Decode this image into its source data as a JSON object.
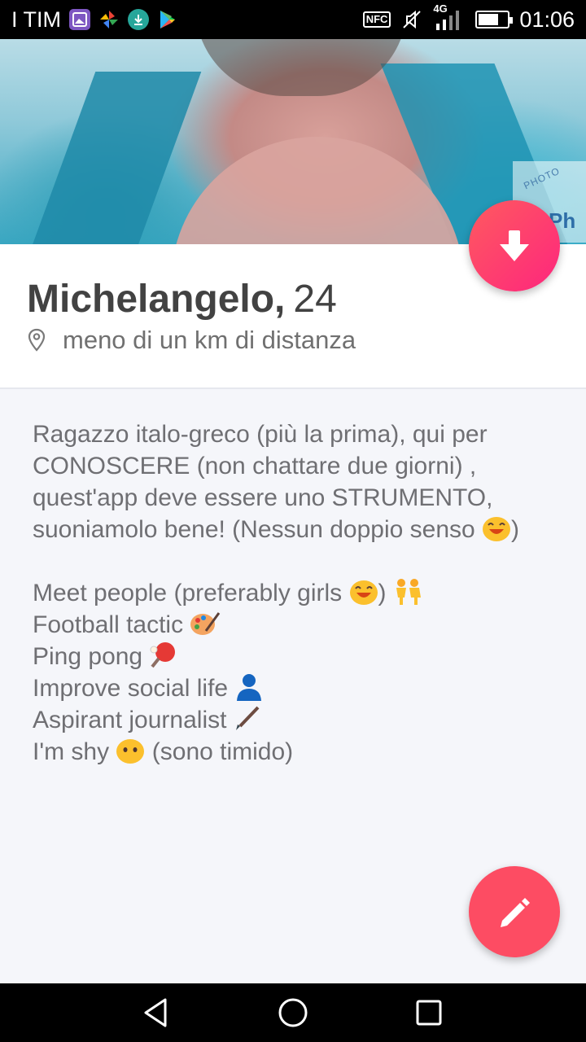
{
  "status_bar": {
    "carrier": "I TIM",
    "network": "4G",
    "time": "01:06",
    "icons": [
      "gallery-icon",
      "pinwheel-icon",
      "download-icon",
      "play-store-icon",
      "nfc-icon",
      "mute-icon",
      "signal-icon",
      "battery-icon"
    ],
    "nfc_label": "NFC",
    "battery_level": 0.7
  },
  "photo": {
    "watermark_top": "PHOTO",
    "watermark_main": "Ph"
  },
  "profile": {
    "name": "Michelangelo,",
    "age": "24",
    "distance": "meno di un km di distanza"
  },
  "bio": {
    "intro_lines": [
      "Ragazzo italo-greco (più la prima), qui per",
      "CONOSCERE (non chattare due giorni) ,",
      "quest'app deve essere uno STRUMENTO,",
      "suoniamolo bene! (Nessun doppio senso"
    ],
    "intro_end": ")",
    "items": [
      {
        "text": "Meet people (preferably girls",
        "after": ")"
      },
      {
        "text": "Football tactic"
      },
      {
        "text": "Ping pong"
      },
      {
        "text": "Improve social life"
      },
      {
        "text": "Aspirant journalist"
      },
      {
        "text": "I'm shy",
        "after": "(sono timido)"
      }
    ]
  },
  "colors": {
    "accent_gradient_start": "#ff5a5f",
    "accent_gradient_end": "#fd267d",
    "edit_fab": "#fd4c63"
  }
}
